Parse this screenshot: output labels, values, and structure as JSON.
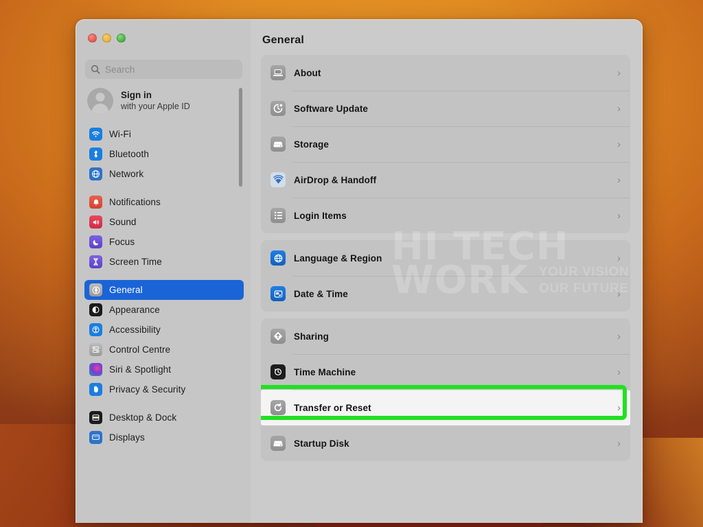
{
  "window": {
    "traffic_lights": [
      "close",
      "minimize",
      "zoom"
    ],
    "title": "General"
  },
  "search": {
    "placeholder": "Search",
    "value": "",
    "icon": "search-icon"
  },
  "account": {
    "title": "Sign in",
    "subtitle": "with your Apple ID",
    "avatar_icon": "person-avatar-icon"
  },
  "sidebar": {
    "groups": [
      {
        "items": [
          {
            "label": "Wi-Fi",
            "icon": "wifi-icon",
            "selected": false
          },
          {
            "label": "Bluetooth",
            "icon": "bluetooth-icon",
            "selected": false
          },
          {
            "label": "Network",
            "icon": "network-globe-icon",
            "selected": false
          }
        ]
      },
      {
        "items": [
          {
            "label": "Notifications",
            "icon": "notifications-bell-icon",
            "selected": false
          },
          {
            "label": "Sound",
            "icon": "sound-speaker-icon",
            "selected": false
          },
          {
            "label": "Focus",
            "icon": "focus-moon-icon",
            "selected": false
          },
          {
            "label": "Screen Time",
            "icon": "screen-time-hourglass-icon",
            "selected": false
          }
        ]
      },
      {
        "items": [
          {
            "label": "General",
            "icon": "general-gear-icon",
            "selected": true
          },
          {
            "label": "Appearance",
            "icon": "appearance-contrast-icon",
            "selected": false
          },
          {
            "label": "Accessibility",
            "icon": "accessibility-person-icon",
            "selected": false
          },
          {
            "label": "Control Centre",
            "icon": "control-centre-icon",
            "selected": false
          },
          {
            "label": "Siri & Spotlight",
            "icon": "siri-orb-icon",
            "selected": false
          },
          {
            "label": "Privacy & Security",
            "icon": "privacy-hand-icon",
            "selected": false
          }
        ]
      },
      {
        "items": [
          {
            "label": "Desktop & Dock",
            "icon": "desktop-dock-icon",
            "selected": false
          },
          {
            "label": "Displays",
            "icon": "displays-icon",
            "selected": false
          }
        ]
      }
    ]
  },
  "content": {
    "title": "General",
    "groups": [
      {
        "rows": [
          {
            "label": "About",
            "icon": "about-laptop-icon",
            "icon_style": "grey",
            "chevron": "›",
            "highlighted": false
          },
          {
            "label": "Software Update",
            "icon": "software-update-icon",
            "icon_style": "grey",
            "chevron": "›",
            "highlighted": false
          },
          {
            "label": "Storage",
            "icon": "storage-drive-icon",
            "icon_style": "grey",
            "chevron": "›",
            "highlighted": false
          },
          {
            "label": "AirDrop & Handoff",
            "icon": "airdrop-icon",
            "icon_style": "airdrop",
            "chevron": "›",
            "highlighted": false
          },
          {
            "label": "Login Items",
            "icon": "login-items-list-icon",
            "icon_style": "grey",
            "chevron": "›",
            "highlighted": false
          }
        ]
      },
      {
        "rows": [
          {
            "label": "Language & Region",
            "icon": "language-globe-icon",
            "icon_style": "blue",
            "chevron": "›",
            "highlighted": false
          },
          {
            "label": "Date & Time",
            "icon": "date-time-clock-icon",
            "icon_style": "blue",
            "chevron": "›",
            "highlighted": false
          }
        ]
      },
      {
        "rows": [
          {
            "label": "Sharing",
            "icon": "sharing-icon",
            "icon_style": "grey",
            "chevron": "›",
            "highlighted": false
          },
          {
            "label": "Time Machine",
            "icon": "time-machine-icon",
            "icon_style": "dark",
            "chevron": "›",
            "highlighted": false
          },
          {
            "label": "Transfer or Reset",
            "icon": "transfer-reset-icon",
            "icon_style": "grey",
            "chevron": "›",
            "highlighted": true
          },
          {
            "label": "Startup Disk",
            "icon": "startup-disk-icon",
            "icon_style": "grey",
            "chevron": "›",
            "highlighted": false
          }
        ]
      }
    ]
  },
  "highlight": {
    "color": "#22e022",
    "target_row": "Transfer or Reset"
  },
  "watermark": {
    "line1": "HI TECH",
    "line2": "WORK",
    "tagline_line1": "YOUR VISION",
    "tagline_line2": "OUR FUTURE"
  },
  "colors": {
    "accent_selected": "#1a64d8",
    "highlight_green": "#22e022",
    "window_bg": "#c9c9c9",
    "card_bg": "#c3c3c3",
    "wallpaper_orange": "#e08a22"
  }
}
